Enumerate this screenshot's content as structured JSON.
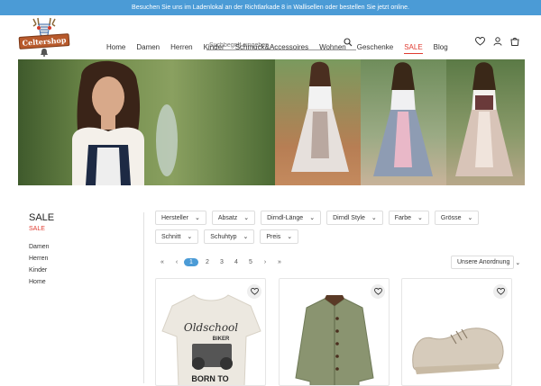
{
  "topbar": {
    "text": "Besuchen Sie uns im Ladenlokal an der Richtlarkade 8 in Wallisellen oder bestellen Sie jetzt online."
  },
  "logo": {
    "text": "Celtershop"
  },
  "search": {
    "placeholder": "Suchbegriff eingeben ..."
  },
  "nav": {
    "items": [
      "Home",
      "Damen",
      "Herren",
      "Kinder",
      "Schmuck&Accessoires",
      "Wohnen",
      "Geschenke",
      "SALE",
      "Blog"
    ]
  },
  "sidebar": {
    "title": "SALE",
    "subtitle": "SALE",
    "items": [
      "Damen",
      "Herren",
      "Kinder",
      "Home"
    ]
  },
  "filters": [
    "Hersteller",
    "Absatz",
    "Dirndl-Länge",
    "Dirndl Style",
    "Farbe",
    "Grösse",
    "Schnitt",
    "Schuhtyp",
    "Preis"
  ],
  "pagination": {
    "first": "«",
    "prev": "‹",
    "pages": [
      "1",
      "2",
      "3",
      "4",
      "5"
    ],
    "next": "›",
    "last": "»",
    "current": "1"
  },
  "sort": {
    "label": "Unsere Anordnung"
  },
  "products": [
    {
      "image_text_1": "Oldschool",
      "image_text_2": "BIKER",
      "image_text_3": "BORN TO"
    },
    {},
    {}
  ],
  "colors": {
    "accent": "#4b9bd6",
    "sale": "#e03c31"
  }
}
